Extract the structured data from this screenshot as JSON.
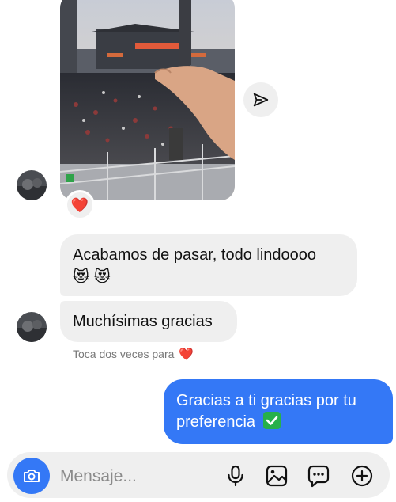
{
  "conversation": {
    "image_message": {
      "reaction_emoji": "❤️",
      "share_icon": "paper-plane-icon"
    },
    "received": [
      {
        "line1": "Acabamos de pasar, todo lindoooo",
        "emojis": [
          "😻",
          "😻"
        ]
      },
      {
        "text": "Muchísimas gracias"
      }
    ],
    "hint": {
      "text": "Toca dos veces para",
      "emoji": "❤️"
    },
    "sent": [
      {
        "line1": "Gracias a ti gracias por tu",
        "line2": "preferencia"
      }
    ]
  },
  "composer": {
    "placeholder": "Mensaje...",
    "icons": [
      "camera-icon",
      "microphone-icon",
      "gallery-icon",
      "sticker-icon",
      "plus-icon"
    ]
  },
  "colors": {
    "accent": "#3478f6",
    "bubble_in": "#efefef",
    "bubble_out": "#3478f6",
    "check_green": "#27b04a"
  }
}
